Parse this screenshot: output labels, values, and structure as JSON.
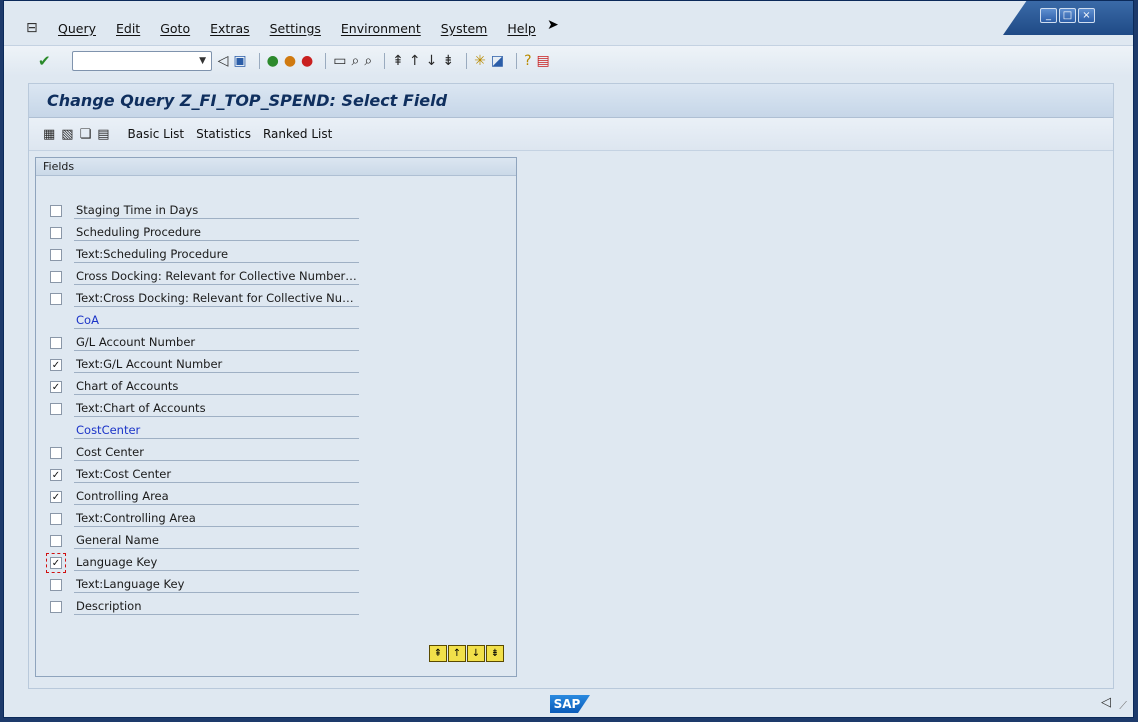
{
  "menubar": {
    "items": [
      "Query",
      "Edit",
      "Goto",
      "Extras",
      "Settings",
      "Environment",
      "System",
      "Help"
    ]
  },
  "window_buttons": [
    "minimize",
    "maximize",
    "close"
  ],
  "toolbar": {
    "okcode_value": "",
    "icons": [
      "enter-icon",
      "back-icon",
      "save-icon",
      "back-green-icon",
      "exit-icon",
      "cancel-icon",
      "print-icon",
      "find-icon",
      "find-next-icon",
      "first-page-icon",
      "previous-page-icon",
      "next-page-icon",
      "last-page-icon",
      "create-session-icon",
      "shortcut-icon",
      "help-icon",
      "layout-icon"
    ]
  },
  "page": {
    "title": "Change Query Z_FI_TOP_SPEND: Select Field"
  },
  "app_toolbar": {
    "buttons": [
      "Basic List",
      "Statistics",
      "Ranked List"
    ]
  },
  "fields_panel": {
    "header": "Fields",
    "rows": [
      {
        "kind": "field",
        "label": "Staging Time in Days",
        "checked": false
      },
      {
        "kind": "field",
        "label": "Scheduling Procedure",
        "checked": false
      },
      {
        "kind": "field",
        "label": "Text:Scheduling Procedure",
        "checked": false
      },
      {
        "kind": "field",
        "label": "Cross Docking: Relevant for Collective Numbering",
        "checked": false
      },
      {
        "kind": "field",
        "label": "Text:Cross Docking: Relevant for Collective Numb...",
        "checked": false
      },
      {
        "kind": "group",
        "label": "CoA"
      },
      {
        "kind": "field",
        "label": "G/L Account Number",
        "checked": false
      },
      {
        "kind": "field",
        "label": "Text:G/L Account Number",
        "checked": true
      },
      {
        "kind": "field",
        "label": "Chart of Accounts",
        "checked": true
      },
      {
        "kind": "field",
        "label": "Text:Chart of Accounts",
        "checked": false
      },
      {
        "kind": "group",
        "label": "CostCenter"
      },
      {
        "kind": "field",
        "label": "Cost Center",
        "checked": false
      },
      {
        "kind": "field",
        "label": "Text:Cost Center",
        "checked": true
      },
      {
        "kind": "field",
        "label": "Controlling Area",
        "checked": true
      },
      {
        "kind": "field",
        "label": "Text:Controlling Area",
        "checked": false
      },
      {
        "kind": "field",
        "label": "General Name",
        "checked": false
      },
      {
        "kind": "field",
        "label": "Language Key",
        "checked": true,
        "focused": true
      },
      {
        "kind": "field",
        "label": "Text:Language Key",
        "checked": false
      },
      {
        "kind": "field",
        "label": "Description",
        "checked": false
      }
    ]
  },
  "status": {
    "logo": "SAP"
  },
  "colors": {
    "group_label": "#1b34c8",
    "title": "#0f2f5e",
    "background": "#dfe8f1"
  }
}
